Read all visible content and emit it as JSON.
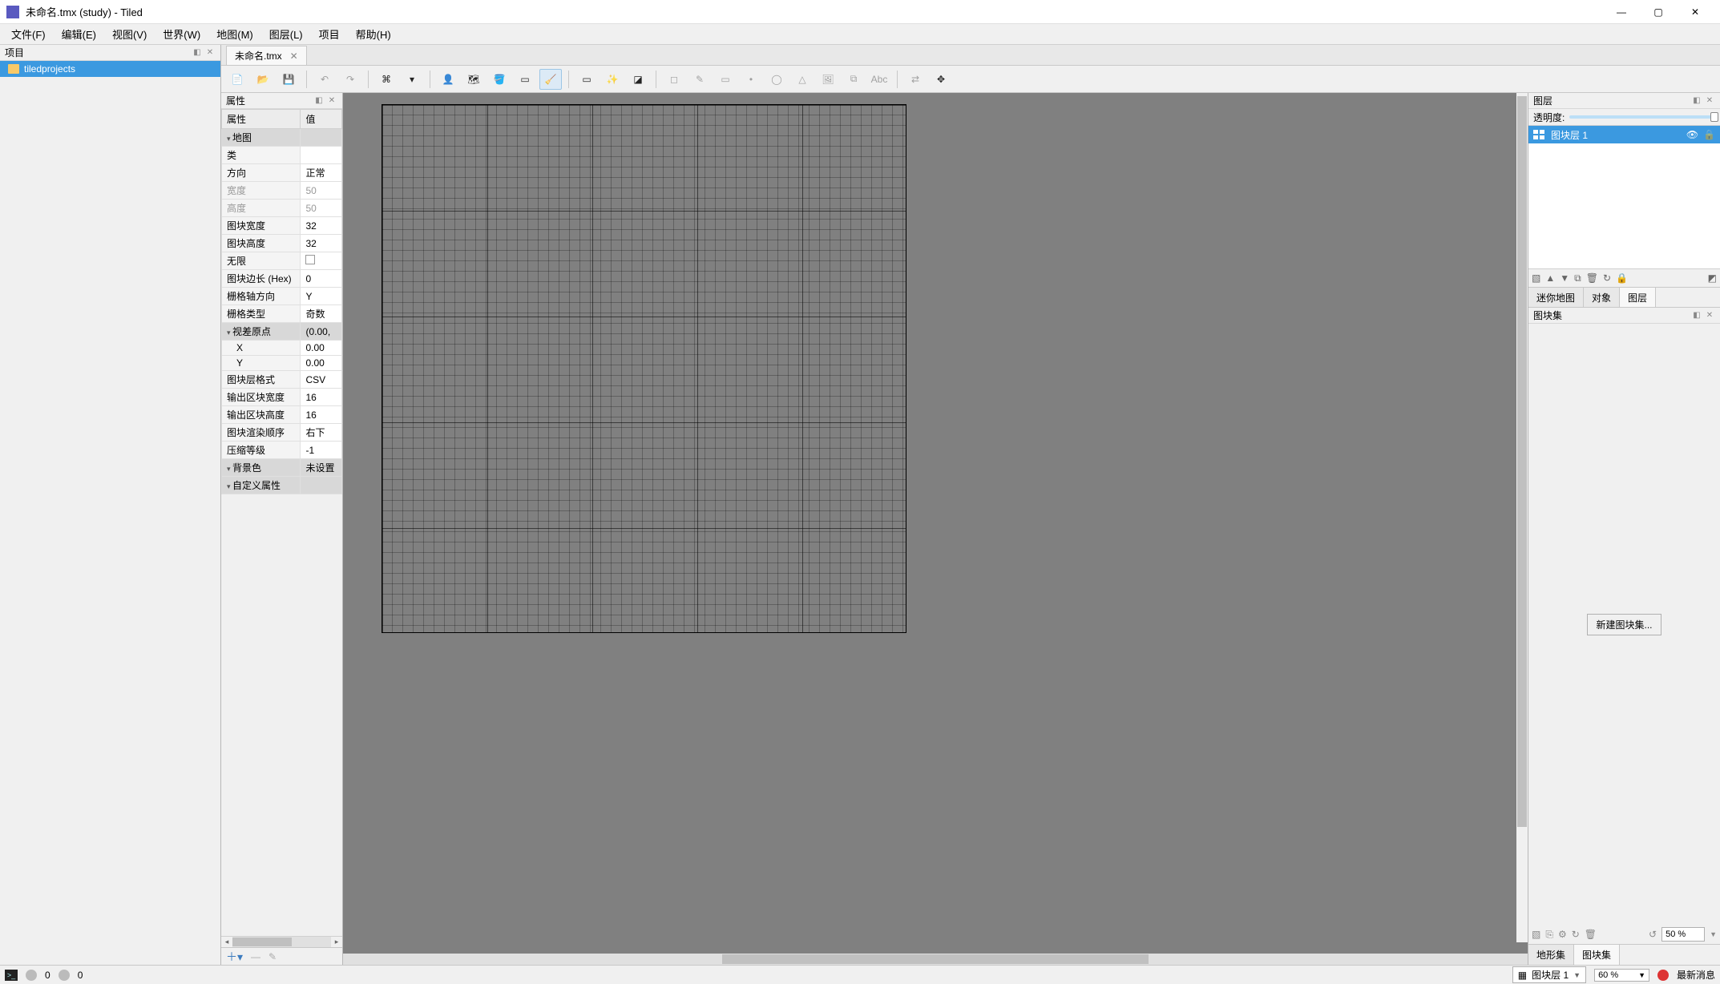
{
  "title": "未命名.tmx (study) - Tiled",
  "menu": [
    "文件(F)",
    "编辑(E)",
    "视图(V)",
    "世界(W)",
    "地图(M)",
    "图层(L)",
    "项目",
    "帮助(H)"
  ],
  "project": {
    "header": "项目",
    "item": "tiledprojects"
  },
  "docTab": {
    "label": "未命名.tmx"
  },
  "toolbar_icons": [
    "new",
    "open",
    "save",
    "|",
    "undo",
    "redo",
    "|",
    "cmd",
    "dd",
    "|",
    "stamp",
    "terrain",
    "bucket",
    "rect",
    "eraser",
    "|",
    "rectsel",
    "wand",
    "same",
    "|",
    "obj-sel",
    "obj-edit",
    "rect-obj",
    "point",
    "ellipse",
    "poly",
    "image",
    "tpl",
    "text",
    "|",
    "ex1",
    "ex2"
  ],
  "props": {
    "header": "属性",
    "cols": [
      "属性",
      "值"
    ],
    "rows": [
      {
        "group": true,
        "k": "地图",
        "v": ""
      },
      {
        "k": "类",
        "v": ""
      },
      {
        "k": "方向",
        "v": "正常"
      },
      {
        "k": "宽度",
        "v": "50",
        "disabled": true
      },
      {
        "k": "高度",
        "v": "50",
        "disabled": true
      },
      {
        "k": "图块宽度",
        "v": "32"
      },
      {
        "k": "图块高度",
        "v": "32"
      },
      {
        "k": "无限",
        "v": "",
        "check": true
      },
      {
        "k": "图块边长 (Hex)",
        "v": "0"
      },
      {
        "k": "栅格轴方向",
        "v": "Y"
      },
      {
        "k": "栅格类型",
        "v": "奇数"
      },
      {
        "group": true,
        "collapsed": false,
        "k": "视差原点",
        "v": "(0.00,"
      },
      {
        "sub": true,
        "k": "X",
        "v": "0.00"
      },
      {
        "sub": true,
        "k": "Y",
        "v": "0.00"
      },
      {
        "k": "图块层格式",
        "v": "CSV"
      },
      {
        "k": "输出区块宽度",
        "v": "16"
      },
      {
        "k": "输出区块高度",
        "v": "16"
      },
      {
        "k": "图块渲染顺序",
        "v": "右下"
      },
      {
        "k": "压缩等级",
        "v": "-1"
      },
      {
        "group": true,
        "collapsed": true,
        "k": "背景色",
        "v": "未设置"
      },
      {
        "group": true,
        "k": "自定义属性",
        "v": ""
      }
    ]
  },
  "layers": {
    "header": "图层",
    "opacity_label": "透明度:",
    "item": "图块层 1",
    "tabs": [
      "迷你地图",
      "对象",
      "图层"
    ],
    "active_tab": 2
  },
  "tileset": {
    "header": "图块集",
    "button": "新建图块集...",
    "tabs": [
      "地形集",
      "图块集"
    ],
    "active_tab": 1,
    "zoom": "50 %"
  },
  "status": {
    "err": "0",
    "warn": "0",
    "layer": "图块层 1",
    "zoom": "60 %",
    "news": "最新消息"
  }
}
